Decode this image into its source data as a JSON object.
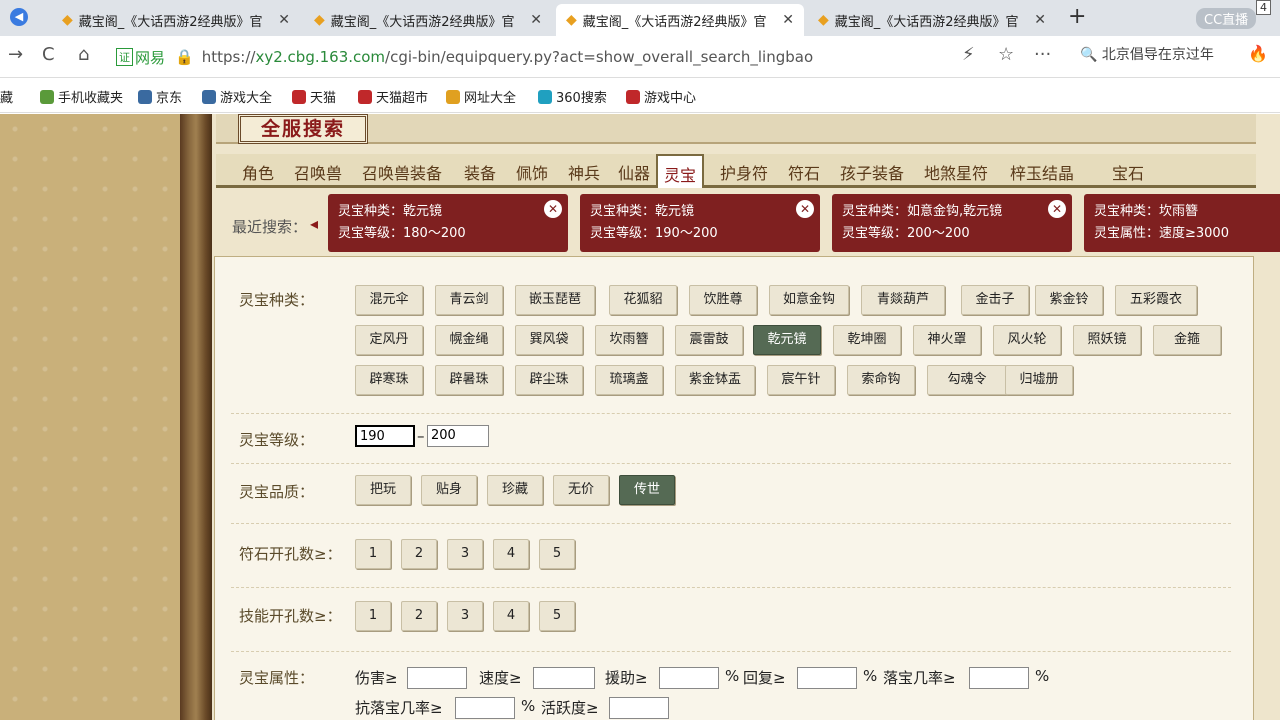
{
  "tabs": [
    {
      "title": "藏宝阁_《大话西游2经典版》官",
      "active": false
    },
    {
      "title": "藏宝阁_《大话西游2经典版》官",
      "active": false
    },
    {
      "title": "藏宝阁_《大话西游2经典版》官",
      "active": true
    },
    {
      "title": "藏宝阁_《大话西游2经典版》官",
      "active": false
    }
  ],
  "tab_close": "✕",
  "new_tab": "+",
  "cc_label": "CC直播",
  "tab_count": "4",
  "nav": {
    "back": "→",
    "reload": "C",
    "home": "⌂",
    "cert": "证",
    "site": "网易",
    "lock": "🔒",
    "url_prefix": "https://",
    "url_host": "xy2.cbg.163.com",
    "url_path": "/cgi-bin/equipquery.py?act=show_overall_search_lingbao",
    "bolt": "⚡",
    "star": "☆",
    "more": "···",
    "search_text": "北京倡导在京过年",
    "flame": "🔥"
  },
  "bookmarks": [
    "藏",
    "手机收藏夹",
    "京东",
    "游戏大全",
    "天猫",
    "天猫超市",
    "网址大全",
    "360搜索",
    "游戏中心"
  ],
  "header_title": "全服搜索",
  "categories": [
    "角色",
    "召唤兽",
    "召唤兽装备",
    "装备",
    "佩饰",
    "神兵",
    "仙器",
    "灵宝",
    "护身符",
    "符石",
    "孩子装备",
    "地煞星符",
    "梓玉结晶",
    "宝石"
  ],
  "active_category": "灵宝",
  "recent": {
    "label": "最近搜索：",
    "cards": [
      {
        "line1": "灵宝种类：乾元镜",
        "line2": "灵宝等级：180～200"
      },
      {
        "line1": "灵宝种类：乾元镜",
        "line2": "灵宝等级：190～200"
      },
      {
        "line1": "灵宝种类：如意金钩,乾元镜",
        "line2": "灵宝等级：200～200"
      },
      {
        "line1": "灵宝种类：坎雨簪",
        "line2": "灵宝属性：速度≥3000"
      }
    ]
  },
  "form": {
    "type_label": "灵宝种类：",
    "types_row1": [
      "混元伞",
      "青云剑",
      "嵌玉琵琶",
      "花狐貂",
      "饮胜尊",
      "如意金钩",
      "青燚葫芦",
      "金击子",
      "紫金铃",
      "五彩霞衣"
    ],
    "types_row2": [
      "定风丹",
      "幌金绳",
      "巽风袋",
      "坎雨簪",
      "震雷鼓",
      "乾元镜",
      "乾坤圈",
      "神火罩",
      "风火轮",
      "照妖镜",
      "金箍"
    ],
    "types_row3": [
      "辟寒珠",
      "辟暑珠",
      "辟尘珠",
      "琉璃盏",
      "紫金钵盂",
      "宸午针",
      "索命钩",
      "勾魂令",
      "归墟册"
    ],
    "selected_type": "乾元镜",
    "level_label": "灵宝等级：",
    "level_min": "190",
    "level_dash": "–",
    "level_max": "200",
    "quality_label": "灵宝品质：",
    "qualities": [
      "把玩",
      "贴身",
      "珍藏",
      "无价",
      "传世"
    ],
    "selected_quality": "传世",
    "rune_label": "符石开孔数≥：",
    "rune_opts": [
      "1",
      "2",
      "3",
      "4",
      "5"
    ],
    "skill_label": "技能开孔数≥：",
    "skill_opts": [
      "1",
      "2",
      "3",
      "4",
      "5"
    ],
    "attr_label": "灵宝属性：",
    "attr1": [
      {
        "label": "伤害≥",
        "pct": ""
      },
      {
        "label": "速度≥",
        "pct": ""
      },
      {
        "label": "援助≥",
        "pct": "%"
      },
      {
        "label": "回复≥",
        "pct": "%"
      },
      {
        "label": "落宝几率≥",
        "pct": "%"
      }
    ],
    "attr2": [
      {
        "label": "抗落宝几率≥",
        "pct": "%"
      },
      {
        "label": "活跃度≥",
        "pct": ""
      }
    ]
  },
  "colors": {
    "accent": "#7f2020",
    "selected": "#556a54"
  }
}
